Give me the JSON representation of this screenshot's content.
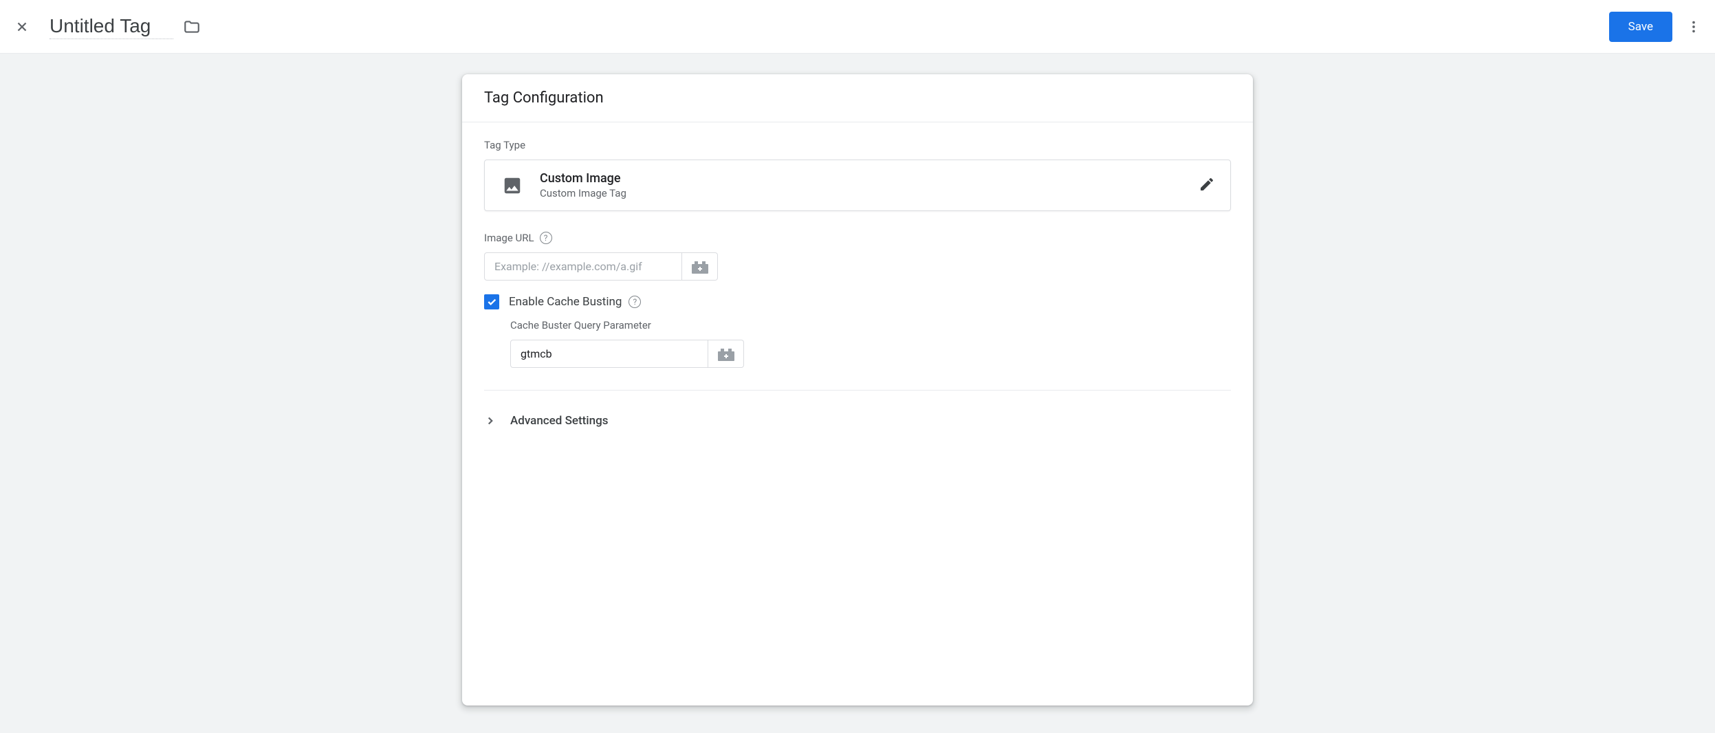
{
  "header": {
    "title": "Untitled Tag",
    "save_label": "Save"
  },
  "panel": {
    "title": "Tag Configuration",
    "tag_type_label": "Tag Type",
    "tag_type": {
      "title": "Custom Image",
      "subtitle": "Custom Image Tag"
    },
    "image_url": {
      "label": "Image URL",
      "placeholder": "Example: //example.com/a.gif",
      "value": ""
    },
    "cache_busting": {
      "label": "Enable Cache Busting",
      "checked": true,
      "param_label": "Cache Buster Query Parameter",
      "param_value": "gtmcb"
    },
    "advanced_label": "Advanced Settings"
  }
}
